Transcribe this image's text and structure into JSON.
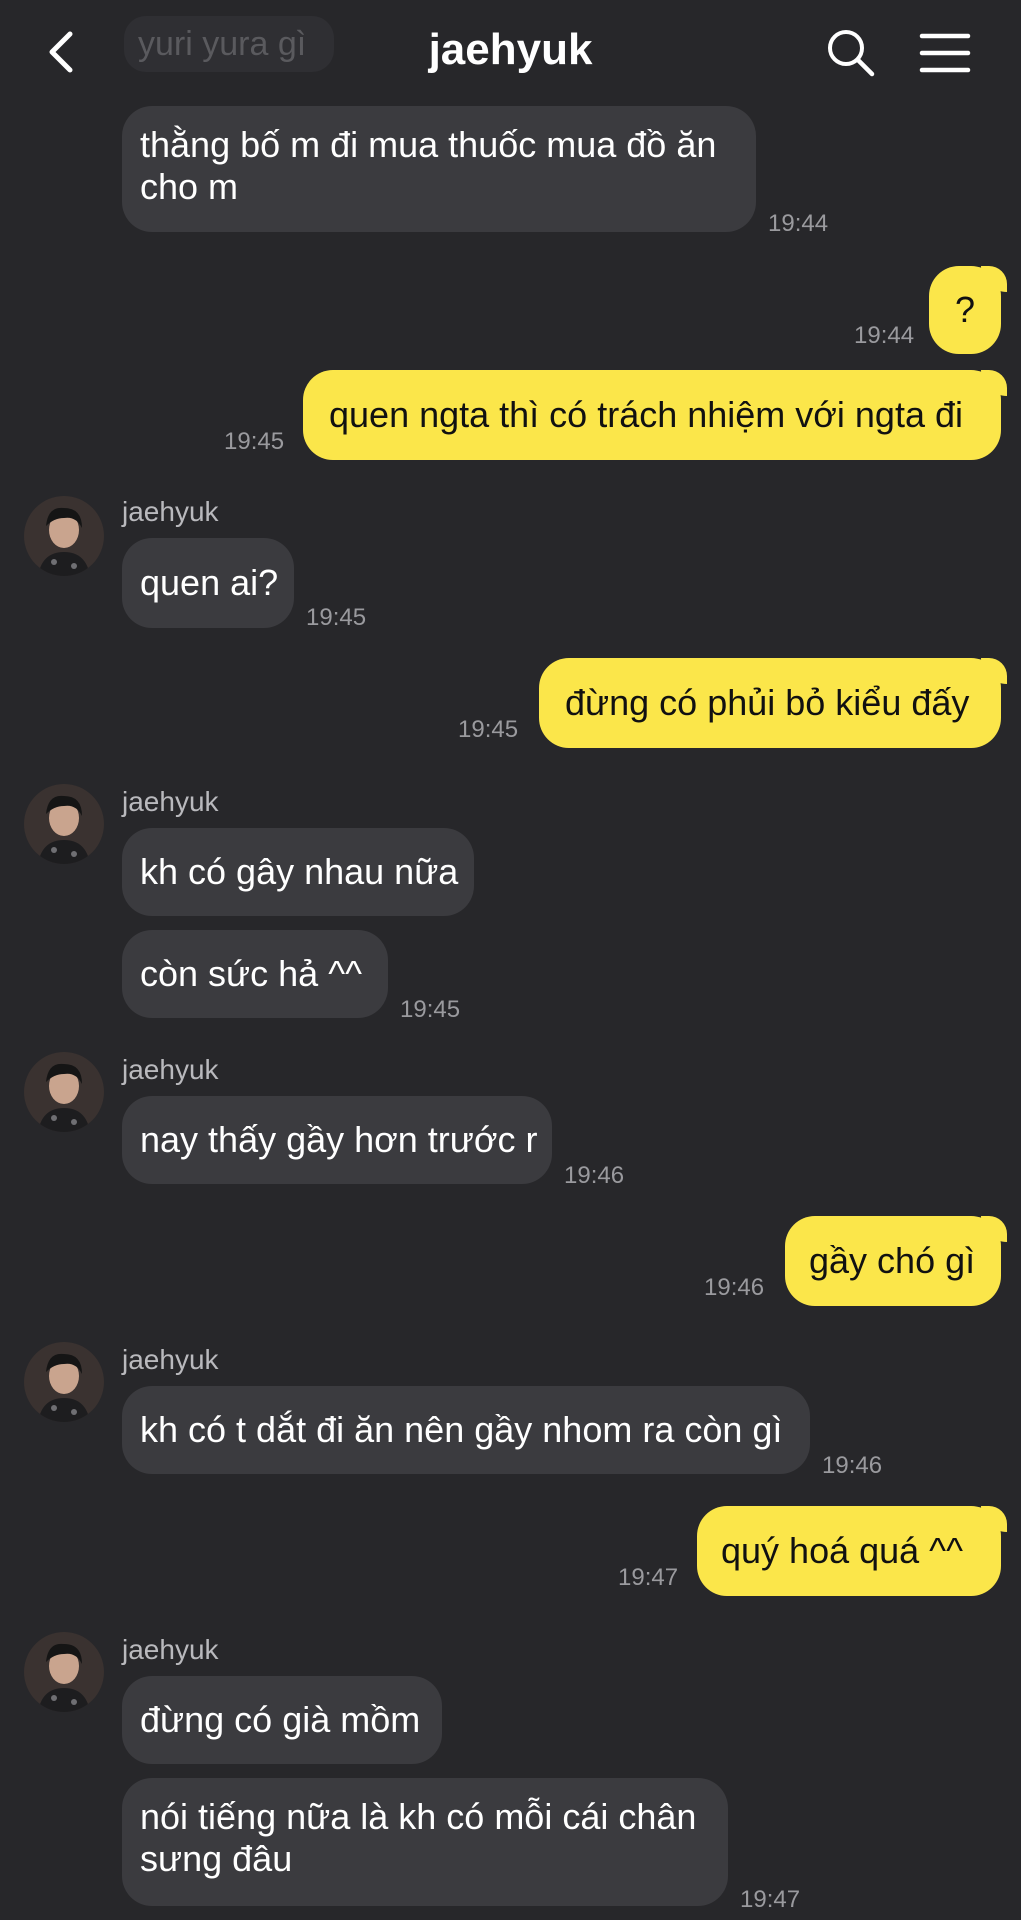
{
  "header": {
    "title": "jaehyuk",
    "partial_previous_message": "yuri yura gì"
  },
  "icons": {
    "back": "chevron-left-icon",
    "search": "search-icon",
    "menu": "menu-icon"
  },
  "colors": {
    "background": "#27272a",
    "incoming_bubble": "#3b3b3f",
    "outgoing_bubble": "#fbe64a"
  },
  "messages": [
    {
      "sender": "other",
      "text": "thằng bố m đi mua thuốc mua đồ ăn cho m",
      "time": "19:44"
    },
    {
      "sender": "me",
      "text": "?",
      "time": "19:44"
    },
    {
      "sender": "me",
      "text": "quen ngta thì có trách nhiệm với ngta đi",
      "time": "19:45"
    },
    {
      "sender": "other",
      "name": "jaehyuk",
      "text": "quen ai?",
      "time": "19:45"
    },
    {
      "sender": "me",
      "text": "đừng có phủi bỏ kiểu đấy",
      "time": "19:45"
    },
    {
      "sender": "other",
      "name": "jaehyuk",
      "text": "kh có gây nhau nữa"
    },
    {
      "sender": "other",
      "text": "còn sức hả ^^",
      "time": "19:45"
    },
    {
      "sender": "other",
      "name": "jaehyuk",
      "text": "nay thấy gầy hơn trước r",
      "time": "19:46"
    },
    {
      "sender": "me",
      "text": "gầy chó gì",
      "time": "19:46"
    },
    {
      "sender": "other",
      "name": "jaehyuk",
      "text": "kh có t dắt đi ăn nên gầy nhom ra còn gì",
      "time": "19:46"
    },
    {
      "sender": "me",
      "text": "quý hoá quá ^^",
      "time": "19:47"
    },
    {
      "sender": "other",
      "name": "jaehyuk",
      "text": "đừng có già mồm"
    },
    {
      "sender": "other",
      "text": "nói tiếng nữa là kh có mỗi cái chân sưng đâu",
      "time": "19:47"
    }
  ]
}
